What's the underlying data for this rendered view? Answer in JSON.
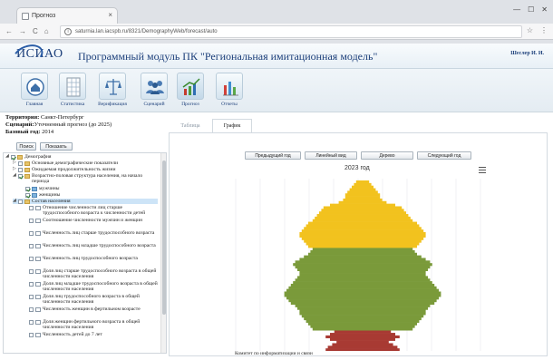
{
  "browser": {
    "tab_title": "Прогноз",
    "tab_close": "×",
    "url": "saturnia.lan.iacspb.ru/8321/DemographyWeb/forecast/auto"
  },
  "header": {
    "logo": "ИСИАО",
    "title": "Программный модуль ПК \"Региональная имитационная модель\"",
    "user": "Шеслер И. И."
  },
  "nav": [
    {
      "label": "Главная",
      "icon": "home-icon"
    },
    {
      "label": "Статистика",
      "icon": "table-icon"
    },
    {
      "label": "Верификация",
      "icon": "scales-icon"
    },
    {
      "label": "Сценарий",
      "icon": "people-icon"
    },
    {
      "label": "Прогноз",
      "icon": "forecast-chart-icon"
    },
    {
      "label": "Отчеты",
      "icon": "report-chart-icon"
    }
  ],
  "info": {
    "territory_label": "Территория:",
    "territory": "Санкт-Петербург",
    "scenario_label": "Сценарий:",
    "scenario": "Уточненный прогноз (до 2025)",
    "base_year_label": "Базовый год:",
    "base_year": "2014"
  },
  "left_buttons": {
    "search": "Поиск",
    "show": "Показать"
  },
  "tree": [
    {
      "text": "Демография"
    },
    {
      "text": "Основные демографические показатели"
    },
    {
      "text": "Ожидаемая продолжительность жизни"
    },
    {
      "text": "Возрастно-половая структура населения, на начало периода"
    },
    {
      "text": "мужчины"
    },
    {
      "text": "женщины"
    },
    {
      "text": "Состав населения"
    },
    {
      "text": "Отношение численности лиц старше трудоспособного возраста к численности детей"
    },
    {
      "text": "Соотношение численности мужчин и женщин"
    },
    {
      "text": "Численность лиц старше трудоспособного возраста"
    },
    {
      "text": "Численность лиц младше трудоспособного возраста"
    },
    {
      "text": "Численность лиц трудоспособного возраста"
    },
    {
      "text": "Доля лиц старше трудоспособного возраста в общей численности населения"
    },
    {
      "text": "Доля лиц младше трудоспособного возраста в общей численности населения"
    },
    {
      "text": "Доля лиц трудоспособного возраста в общей численности населения"
    },
    {
      "text": "Численность женщин в фертильном возрасте"
    },
    {
      "text": "Доля женщин фертильного возраста в общей численности населения"
    },
    {
      "text": "Численность детей до 7 лет"
    }
  ],
  "content_tabs": {
    "table": "Таблица",
    "chart": "График"
  },
  "controls": {
    "prev_year": "Предыдущий год",
    "linear_view": "Линейный вид",
    "tree": "Дерево",
    "next_year": "Следующий год"
  },
  "chart_data": {
    "type": "bar",
    "title": "2023 год",
    "subtype": "population-pyramid (mirrored horizontal bars, age bands stacked bottom to top)",
    "series_colors": {
      "young": "#a83a33",
      "working": "#7a9a3a",
      "elderly": "#f2c21e"
    },
    "bands": [
      {
        "group": "young",
        "widths": [
          0.34,
          0.32,
          0.28,
          0.24,
          0.3,
          0.34,
          0.3,
          0.26
        ]
      },
      {
        "group": "working",
        "widths": [
          0.46,
          0.48,
          0.5,
          0.52,
          0.54,
          0.56,
          0.58,
          0.58,
          0.6,
          0.62,
          0.66,
          0.68,
          0.7,
          0.72,
          0.72,
          0.7,
          0.68,
          0.66,
          0.64,
          0.62,
          0.6,
          0.58,
          0.58,
          0.6,
          0.62,
          0.64,
          0.62,
          0.58,
          0.54,
          0.5,
          0.48,
          0.46
        ]
      },
      {
        "group": "elderly",
        "widths": [
          0.5,
          0.52,
          0.54,
          0.56,
          0.58,
          0.58,
          0.56,
          0.54,
          0.52,
          0.5,
          0.46,
          0.44,
          0.42,
          0.4,
          0.38,
          0.36,
          0.3,
          0.22,
          0.18,
          0.16,
          0.16,
          0.14,
          0.12,
          0.1,
          0.08,
          0.06
        ]
      }
    ]
  },
  "footer_note": "Комитет по информатизации и связи"
}
